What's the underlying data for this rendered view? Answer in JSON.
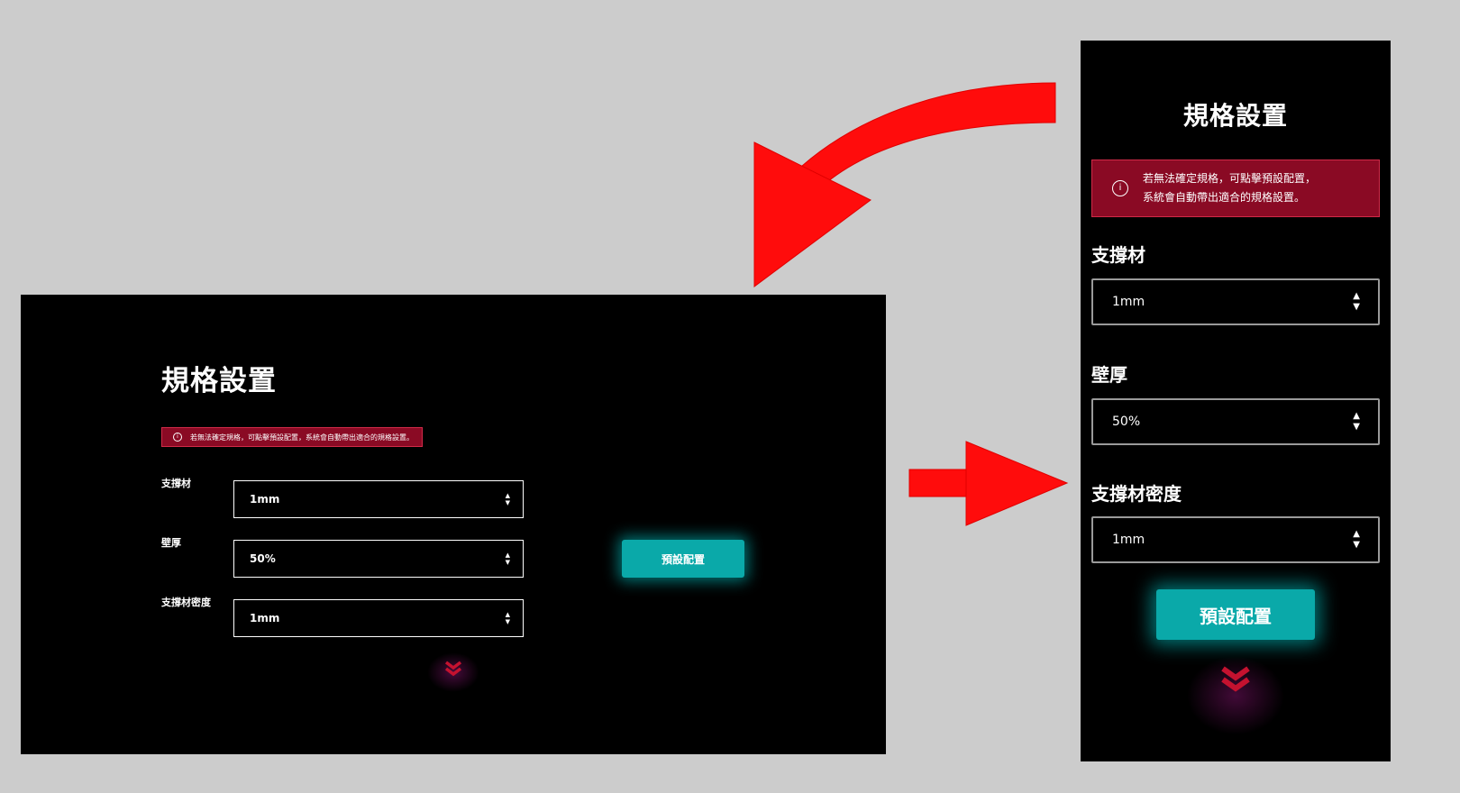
{
  "page": {
    "title": "規格設置",
    "alert_text": "若無法確定規格，可點擊預設配置，系統會自動帶出適合的規格設置。",
    "alert_line1": "若無法確定規格，可點擊預設配置，",
    "alert_line2": "系統會自動帶出適合的規格設置。",
    "info_icon": "info-icon",
    "fields": [
      {
        "label": "支撐材",
        "value": "1mm"
      },
      {
        "label": "壁厚",
        "value": "50%"
      },
      {
        "label": "支撐材密度",
        "value": "1mm"
      }
    ],
    "preset_button": "預設配置",
    "scroll_icon": "double-chevron-down-icon"
  },
  "colors": {
    "background": "#000000",
    "canvas": "#cccccc",
    "alert_bg": "#8a0a24",
    "alert_border": "#d12a48",
    "accent": "#0aa9a9",
    "chevron": "#c4122f",
    "arrow": "#ff0c0c"
  }
}
